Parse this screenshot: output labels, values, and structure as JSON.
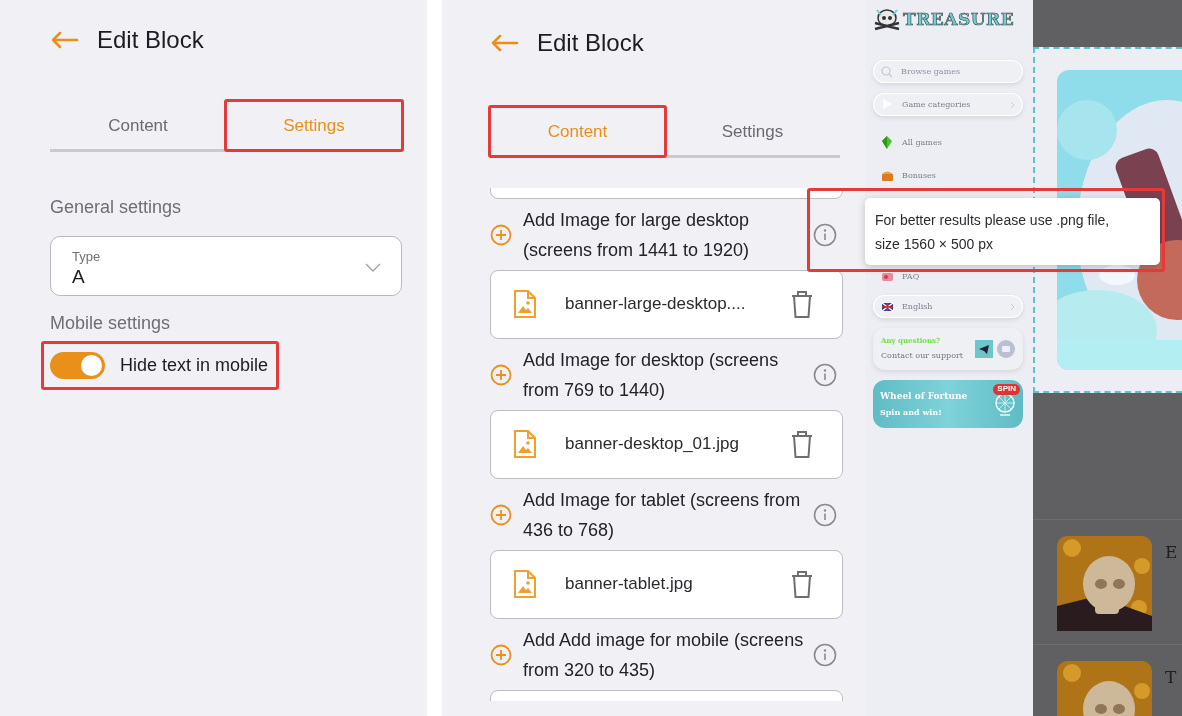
{
  "settings_panel": {
    "title": "Edit Block",
    "tabs": [
      {
        "label": "Content",
        "selected": false,
        "highlighted": false
      },
      {
        "label": "Settings",
        "selected": true,
        "highlighted": true
      }
    ],
    "sections": [
      {
        "heading": "General settings",
        "fields": [
          {
            "kind": "select",
            "label": "Type",
            "value": "A"
          }
        ]
      },
      {
        "heading": "Mobile settings",
        "fields": [
          {
            "kind": "toggle",
            "label": "Hide text in mobile",
            "on": true,
            "highlighted": true
          }
        ]
      }
    ]
  },
  "content_panel": {
    "title": "Edit Block",
    "tabs": [
      {
        "label": "Content",
        "selected": true,
        "highlighted": true
      },
      {
        "label": "Settings",
        "selected": false,
        "highlighted": false
      }
    ],
    "uploads": [
      {
        "label": "Add Image for large desktop (screens from 1441 to 1920)",
        "file": "banner-large-desktop...."
      },
      {
        "label": "Add Image for desktop (screens from 769 to 1440)",
        "file": "banner-desktop_01.jpg"
      },
      {
        "label": "Add Image for tablet (screens from 436 to 768)",
        "file": "banner-tablet.jpg"
      },
      {
        "label": "Add Add image for mobile (screens from 320 to 435)"
      }
    ]
  },
  "tooltip": {
    "text": "For better results please use .png file, size 1560 × 500 px",
    "highlighted": true
  },
  "preview": {
    "logo": "TREASURE",
    "search": {
      "placeholder": "Browse games"
    },
    "menu": [
      {
        "label": "Game categories",
        "kind": "pill"
      },
      {
        "label": "All games",
        "kind": "gem"
      },
      {
        "label": "Bonuses",
        "kind": "chest"
      },
      {
        "label": "FAQ",
        "kind": "faq"
      },
      {
        "label": "English",
        "kind": "language"
      }
    ],
    "support": {
      "title": "Any questions?",
      "subtitle": "Contact our support"
    },
    "promo": {
      "title": "Wheel of Fortune",
      "subtitle": "Spin and win!",
      "badge": "SPIN"
    },
    "games": [
      {
        "title": "E"
      },
      {
        "title": "T"
      }
    ]
  }
}
